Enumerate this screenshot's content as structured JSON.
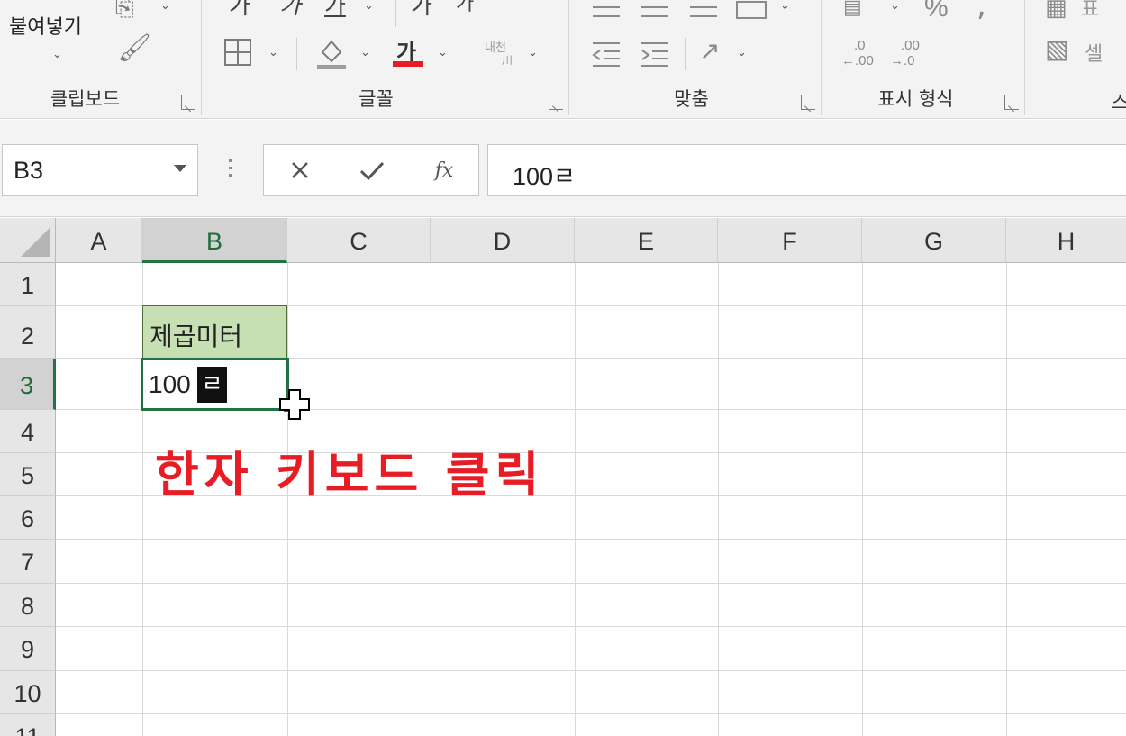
{
  "ribbon": {
    "clipboard": {
      "paste_label": "붙여넣기",
      "group_label": "클립보드"
    },
    "font": {
      "group_label": "글꼴",
      "font_color_glyph": "가",
      "font_color": "#e81c24",
      "phonetic_label": "내천"
    },
    "alignment": {
      "group_label": "맞춤"
    },
    "number": {
      "group_label": "표시 형식",
      "percent_glyph": "%"
    },
    "styles": {
      "cell_styles_label": "셀"
    }
  },
  "formula_bar": {
    "name_box_value": "B3",
    "formula_value": "100ㄹ",
    "fx_label": "fx"
  },
  "sheet": {
    "columns": [
      "A",
      "B",
      "C",
      "D",
      "E",
      "F",
      "G",
      "H"
    ],
    "rows": [
      "1",
      "2",
      "3",
      "4",
      "5",
      "6",
      "7",
      "8",
      "9",
      "10",
      "11"
    ],
    "selected_column": "B",
    "selected_row": "3",
    "cells": {
      "B2": {
        "value": "제곱미터",
        "fill": "#c6e0b4"
      },
      "B3": {
        "value": "100",
        "composing_char": "ㄹ"
      }
    }
  },
  "annotation": {
    "text": "한자 키보드 클릭",
    "color": "#e81c24"
  },
  "colors": {
    "accent": "#217346",
    "ribbon_bg": "#f3f3f3"
  }
}
